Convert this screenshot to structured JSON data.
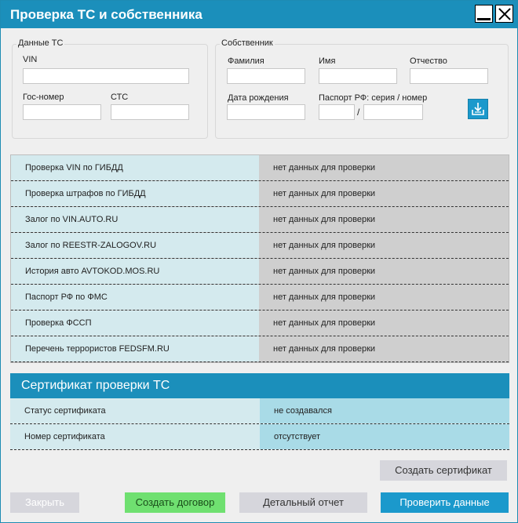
{
  "window": {
    "title": "Проверка ТС и собственника"
  },
  "vehicle": {
    "legend": "Данные ТС",
    "vin_label": "VIN",
    "vin_value": "",
    "plate_label": "Гос-номер",
    "plate_value": "",
    "sts_label": "СТС",
    "sts_value": ""
  },
  "owner": {
    "legend": "Собственник",
    "last_name_label": "Фамилия",
    "last_name_value": "",
    "first_name_label": "Имя",
    "first_name_value": "",
    "patronymic_label": "Отчество",
    "patronymic_value": "",
    "birth_date_label": "Дата рождения",
    "birth_date_value": "",
    "passport_label": "Паспорт РФ: серия / номер",
    "passport_series_value": "",
    "passport_separator": "/",
    "passport_number_value": "",
    "load_icon": "download-tray-icon"
  },
  "checks": [
    {
      "name": "Проверка VIN по ГИБДД",
      "status": "нет данных для проверки"
    },
    {
      "name": "Проверка штрафов по ГИБДД",
      "status": "нет данных для проверки"
    },
    {
      "name": "Залог по VIN.AUTO.RU",
      "status": "нет данных для проверки"
    },
    {
      "name": "Залог по REESTR-ZALOGOV.RU",
      "status": "нет данных для проверки"
    },
    {
      "name": "История авто AVTOKOD.MOS.RU",
      "status": "нет данных для проверки"
    },
    {
      "name": "Паспорт РФ по ФМС",
      "status": "нет данных для проверки"
    },
    {
      "name": "Проверка ФССП",
      "status": "нет данных для проверки"
    },
    {
      "name": "Перечень террористов FEDSFM.RU",
      "status": "нет данных для проверки"
    }
  ],
  "certificate": {
    "title": "Сертификат проверки ТС",
    "rows": [
      {
        "label": "Статус сертификата",
        "value": "не создавался"
      },
      {
        "label": "Номер сертификата",
        "value": "отсутствует"
      }
    ],
    "create_label": "Создать сертификат"
  },
  "footer": {
    "close_label": "Закрыть",
    "contract_label": "Создать договор",
    "report_label": "Детальный отчет",
    "verify_label": "Проверить данные"
  },
  "colors": {
    "accent": "#1b8fbb",
    "green_button": "#6fe070",
    "row_label_bg": "#d4eaee",
    "row_value_bg": "#cfcfcf",
    "cert_value_bg": "#a9dbe7"
  }
}
